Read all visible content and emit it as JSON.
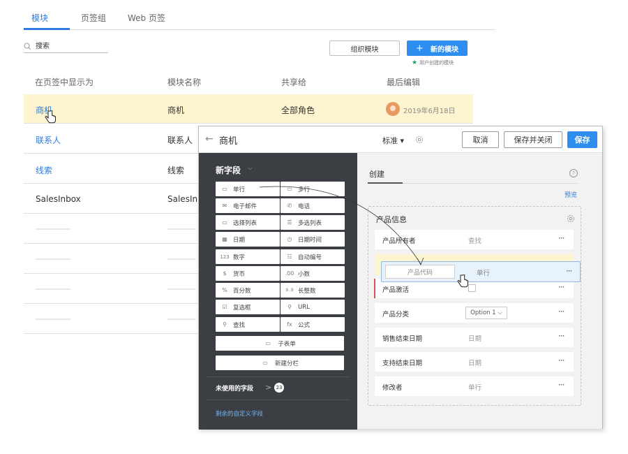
{
  "tabs": [
    {
      "label": "模块",
      "active": true
    },
    {
      "label": "页签组",
      "active": false
    },
    {
      "label": "Web 页签",
      "active": false
    }
  ],
  "search": {
    "value": "搜索",
    "icon": "search-icon"
  },
  "toolbar": {
    "org_label": "组织模块",
    "new_plus": "+",
    "new_label": "新的模块",
    "user_created_note": "用户创建的模块",
    "note_star": "★"
  },
  "table": {
    "headers": [
      "在页签中显示为",
      "模块名称",
      "共享给",
      "最后编辑"
    ],
    "rows": [
      {
        "display": "商机",
        "name": "商机",
        "shared": "全部角色",
        "edited": "2019年6月18日",
        "highlight": true
      },
      {
        "display": "联系人",
        "name": "联系人",
        "shared": "",
        "edited": "",
        "highlight": false
      },
      {
        "display": "线索",
        "name": "线索",
        "shared": "",
        "edited": "",
        "highlight": false
      },
      {
        "display": "SalesInbox",
        "name": "SalesInb",
        "shared": "",
        "edited": "",
        "highlight": false
      }
    ]
  },
  "editor": {
    "back": "←",
    "title": "商机",
    "layout_label": "标准 ▾",
    "cancel_label": "取消",
    "save_close_label": "保存并关闭",
    "save_label": "保存",
    "palette": {
      "title": "新字段",
      "title_chevron": "⌵",
      "fields": [
        {
          "label": "单行",
          "icon": "single-line-icon",
          "glyph": "▭"
        },
        {
          "label": "多行",
          "icon": "multi-line-icon",
          "glyph": "▭"
        },
        {
          "label": "电子邮件",
          "icon": "email-icon",
          "glyph": "✉"
        },
        {
          "label": "电话",
          "icon": "phone-icon",
          "glyph": "✆"
        },
        {
          "label": "选择列表",
          "icon": "picklist-icon",
          "glyph": "▭"
        },
        {
          "label": "多选列表",
          "icon": "multi-select-icon",
          "glyph": "☰"
        },
        {
          "label": "日期",
          "icon": "date-icon",
          "glyph": "▦"
        },
        {
          "label": "日期时间",
          "icon": "datetime-icon",
          "glyph": "◷"
        },
        {
          "label": "数字",
          "icon": "number-icon",
          "glyph": "123"
        },
        {
          "label": "自动编号",
          "icon": "auto-number-icon",
          "glyph": "☷"
        },
        {
          "label": "货币",
          "icon": "currency-icon",
          "glyph": "$"
        },
        {
          "label": "小数",
          "icon": "decimal-icon",
          "glyph": ".00"
        },
        {
          "label": "百分数",
          "icon": "percent-icon",
          "glyph": "%"
        },
        {
          "label": "长整数",
          "icon": "long-integer-icon",
          "glyph": "9..9"
        },
        {
          "label": "复选框",
          "icon": "checkbox-icon",
          "glyph": "☑"
        },
        {
          "label": "URL",
          "icon": "url-icon",
          "glyph": "⚲"
        },
        {
          "label": "查找",
          "icon": "lookup-icon",
          "glyph": "⚲"
        },
        {
          "label": "公式",
          "icon": "formula-icon",
          "glyph": "fx"
        }
      ],
      "subform_label": "子表单",
      "new_section_label": "新建分栏",
      "unused_label": "未使用的字段",
      "unused_arrow": ">",
      "unused_count": "23",
      "custom_label": "剩余的自定义字段"
    },
    "canvas": {
      "tab_label": "创建",
      "help": "?",
      "preview_label": "预览",
      "section_title": "产品信息",
      "fields": [
        {
          "label": "产品所有者",
          "value": "查找"
        },
        {
          "label": "产品激活",
          "value": ""
        },
        {
          "label": "产品分类",
          "value": "Option 1"
        },
        {
          "label": "销售结束日期",
          "value": "日期"
        },
        {
          "label": "支持结束日期",
          "value": "日期"
        },
        {
          "label": "修改者",
          "value": "单行"
        }
      ],
      "more": "···"
    },
    "dragging": {
      "placeholder": "产品代码",
      "type": "单行",
      "more": "···"
    }
  }
}
